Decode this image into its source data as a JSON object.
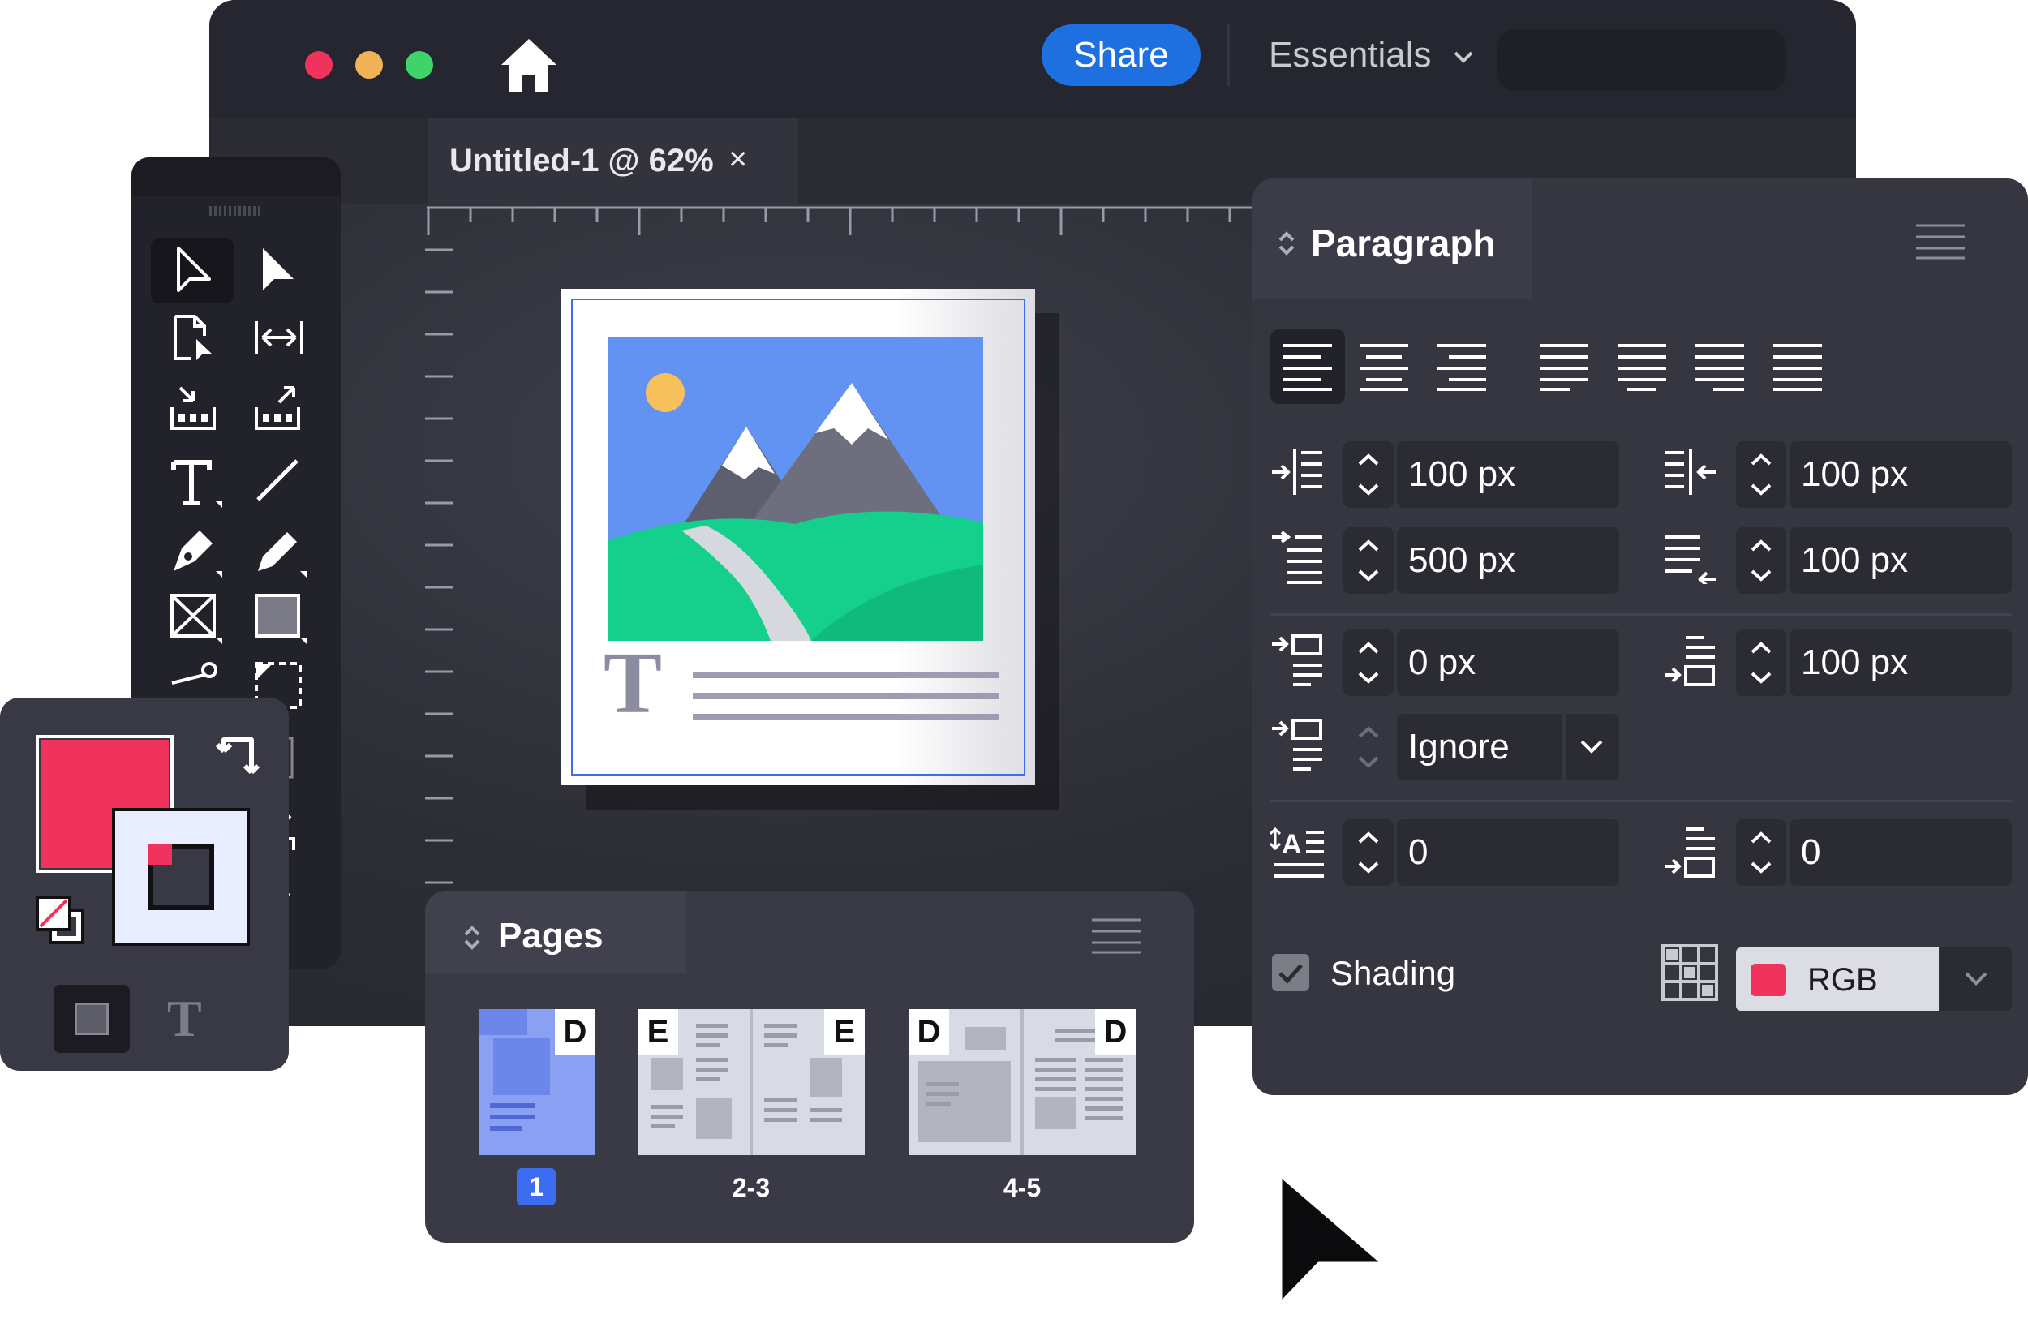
{
  "window": {
    "traffic_lights": [
      "#f0335d",
      "#f2b356",
      "#3fd46a"
    ],
    "home_icon": "home-icon",
    "share_label": "Share",
    "workspace_label": "Essentials",
    "tab_title": "Untitled-1 @ 62%",
    "tab_close": "×"
  },
  "paragraph_panel": {
    "title": "Paragraph",
    "left_indent": "100 px",
    "right_indent": "100 px",
    "first_line_indent": "500 px",
    "last_line_indent": "100 px",
    "space_before": "0 px",
    "space_after": "100 px",
    "align_to_grid": "Ignore",
    "drop_cap_lines": "0",
    "drop_cap_chars": "0",
    "shading_label": "Shading",
    "shading_checked": true,
    "color_mode": "RGB",
    "shading_swatch": "#f0335d"
  },
  "pages_panel": {
    "title": "Pages",
    "pages": [
      {
        "label": "1",
        "letters": [
          "D"
        ],
        "selected": true
      },
      {
        "label": "2-3",
        "letters": [
          "E",
          "E"
        ],
        "selected": false
      },
      {
        "label": "4-5",
        "letters": [
          "D",
          "D"
        ],
        "selected": false
      }
    ]
  },
  "colors": {
    "fill": "#f0335d",
    "stroke_bg": "#e8eeff",
    "accent": "#1e6fe0",
    "page_badge": "#3c6cf0"
  },
  "type_glyph": "T"
}
